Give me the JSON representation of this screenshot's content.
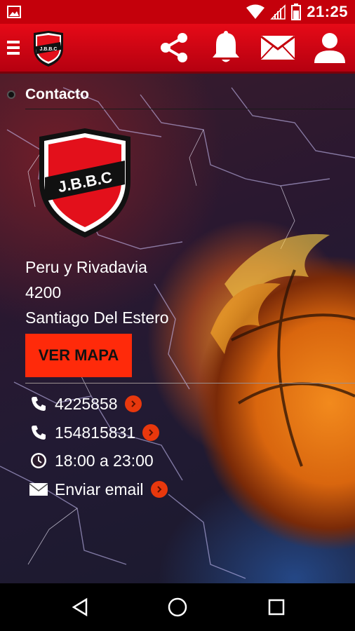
{
  "status_bar": {
    "time": "21:25",
    "icons": [
      "image-icon",
      "wifi-icon",
      "signal-icon",
      "battery-icon"
    ]
  },
  "app_bar": {
    "logo_text": "J.B.B.C",
    "actions": [
      "share-icon",
      "bell-icon",
      "mail-icon",
      "user-icon"
    ],
    "brand_color": "#d9000f"
  },
  "section": {
    "title": "Contacto"
  },
  "club_logo": {
    "text": "J.B.B.C"
  },
  "address": {
    "street": "Peru y Rivadavia",
    "postal_code": "4200",
    "city": "Santiago Del Estero"
  },
  "map_button": {
    "label": "VER MAPA",
    "color": "#ff2a0a"
  },
  "contact_rows": [
    {
      "icon": "phone-icon",
      "text": "4225858",
      "has_arrow": true
    },
    {
      "icon": "phone-icon",
      "text": "154815831",
      "has_arrow": true
    },
    {
      "icon": "clock-icon",
      "text": "18:00 a 23:00",
      "has_arrow": false
    },
    {
      "icon": "envelope-icon",
      "text": "Enviar email",
      "has_arrow": true
    }
  ],
  "nav_bar": {
    "buttons": [
      "back-icon",
      "home-icon",
      "recents-icon"
    ]
  }
}
